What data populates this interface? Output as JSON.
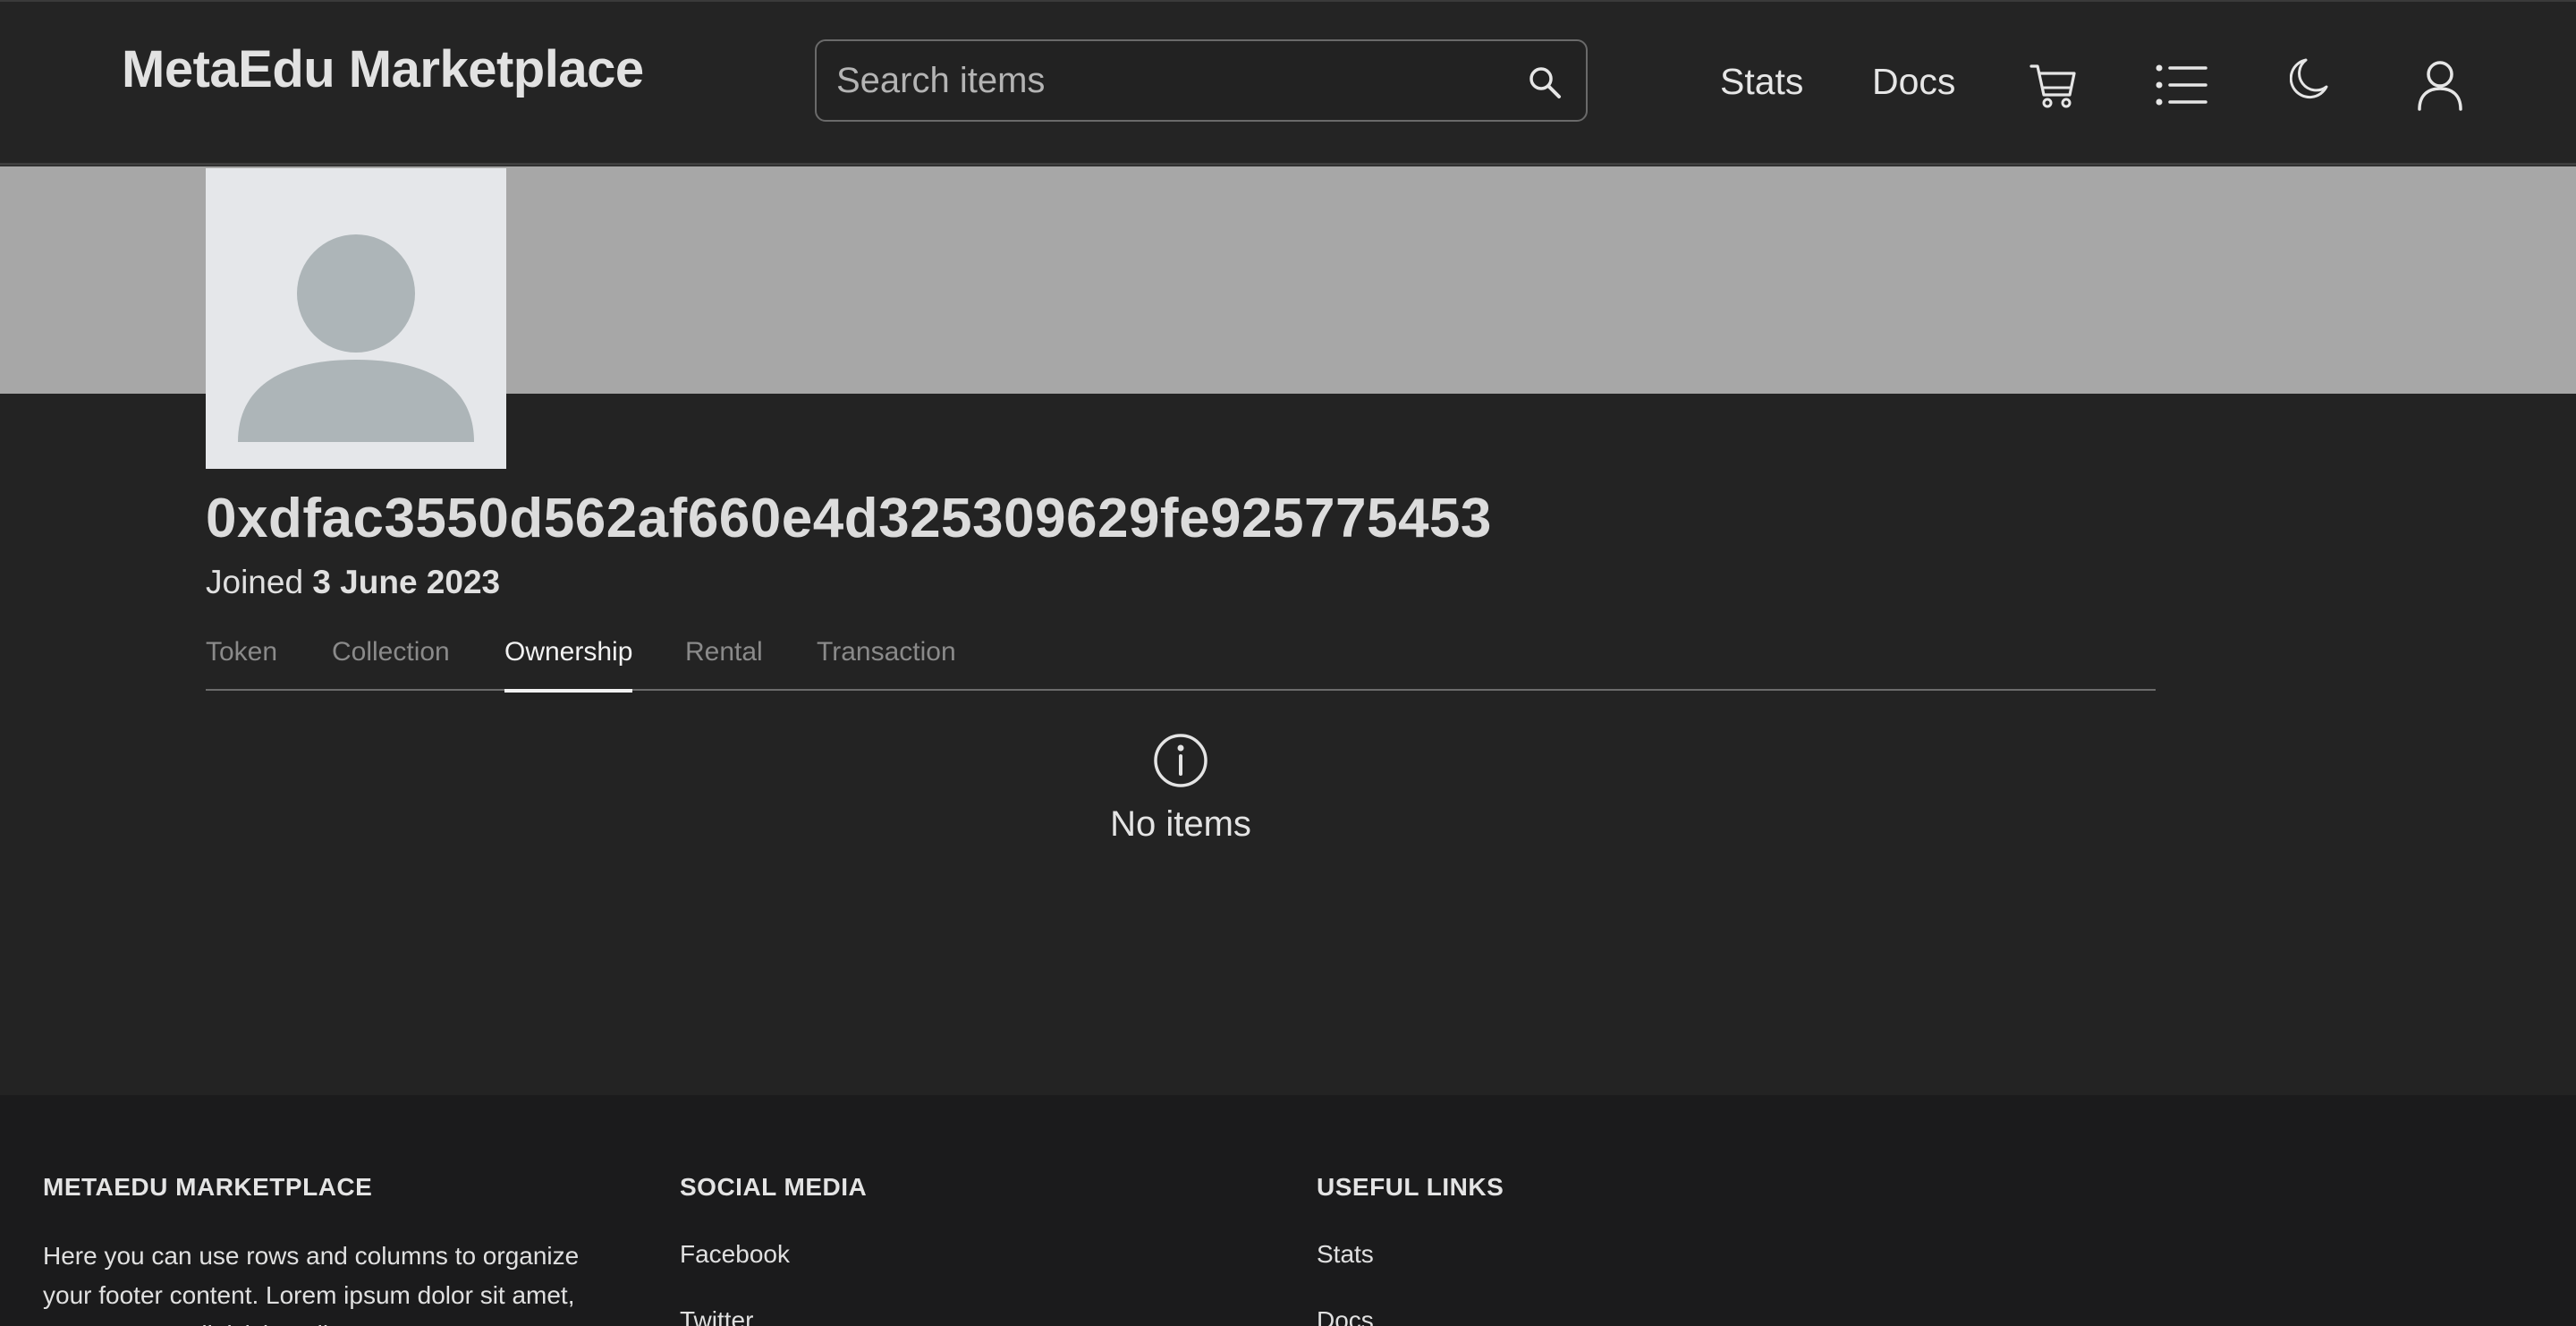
{
  "header": {
    "brand": "MetaEdu Marketplace",
    "search": {
      "placeholder": "Search items",
      "icon": "search-icon"
    },
    "nav_links": [
      "Stats",
      "Docs"
    ],
    "icons": [
      "cart-icon",
      "list-icon",
      "moon-icon",
      "user-icon"
    ]
  },
  "profile": {
    "address": "0xdfac3550d562af660e4d325309629fe925775453",
    "joined_prefix": "Joined",
    "joined_date": "3 June 2023",
    "avatar_icon": "avatar-placeholder-icon"
  },
  "tabs": [
    {
      "label": "Token",
      "active": false
    },
    {
      "label": "Collection",
      "active": false
    },
    {
      "label": "Ownership",
      "active": true
    },
    {
      "label": "Rental",
      "active": false
    },
    {
      "label": "Transaction",
      "active": false
    }
  ],
  "empty_state": {
    "icon": "info-icon",
    "text": "No items"
  },
  "footer": {
    "col1": {
      "heading": "METAEDU MARKETPLACE",
      "text": "Here you can use rows and columns to organize your footer content. Lorem ipsum dolor sit amet, consectetur adipisicing elit."
    },
    "col2": {
      "heading": "SOCIAL MEDIA",
      "links": [
        "Facebook",
        "Twitter"
      ]
    },
    "col3": {
      "heading": "USEFUL LINKS",
      "links": [
        "Stats",
        "Docs"
      ]
    }
  },
  "colors": {
    "background": "#232323",
    "navbar": "#242424",
    "banner": "#a7a7a7",
    "avatar_bg": "#e5e7ea",
    "avatar_fg": "#adb5b8",
    "footer": "#1b1b1c"
  }
}
